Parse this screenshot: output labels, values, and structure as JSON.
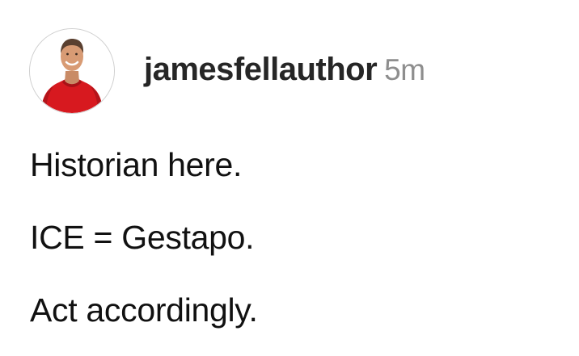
{
  "post": {
    "author": {
      "username": "jamesfellauthor",
      "avatar_icon": "profile-photo"
    },
    "timestamp": "5m",
    "lines": [
      "Historian here.",
      "ICE = Gestapo.",
      "Act accordingly."
    ]
  },
  "colors": {
    "username": "#262626",
    "timestamp": "#8e8e8e",
    "text": "#111111",
    "avatar_shirt": "#d7191f"
  }
}
